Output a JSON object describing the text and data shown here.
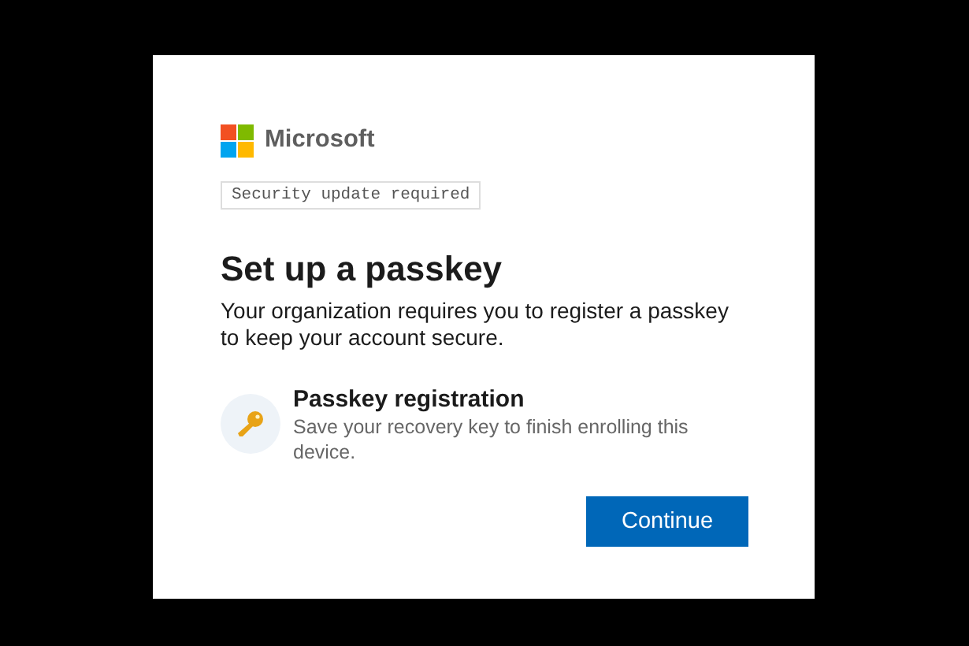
{
  "brand": {
    "name": "Microsoft"
  },
  "badge": "Security update required",
  "heading": "Set up a passkey",
  "description": "Your organization requires you to register a passkey to keep your account secure.",
  "step": {
    "title": "Passkey registration",
    "text": "Save your recovery key to finish enrolling this device."
  },
  "buttons": [
    "Continue"
  ]
}
